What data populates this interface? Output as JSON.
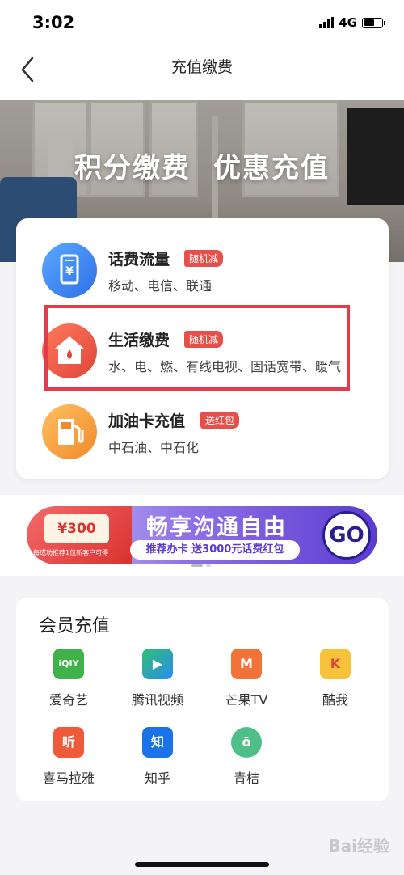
{
  "status_bar": {
    "time": "3:02",
    "network": "4G"
  },
  "nav": {
    "title": "充值缴费"
  },
  "hero": {
    "left_text": "积分缴费",
    "right_text": "优惠充值"
  },
  "services": [
    {
      "name": "话费流量",
      "tag": "随机减",
      "desc": "移动、电信、联通"
    },
    {
      "name": "生活缴费",
      "tag": "随机减",
      "desc": "水、电、燃、有线电视、固话宽带、暖气"
    },
    {
      "name": "加油卡充值",
      "tag": "送红包",
      "desc": "中石油、中石化"
    }
  ],
  "promo": {
    "coupon": "¥300",
    "note": "每成功推荐1位新客户可得",
    "title": "畅享沟通自由",
    "subtitle": "推荐办卡 送3000元话费红包",
    "go": "GO"
  },
  "member": {
    "title": "会员充值",
    "items": [
      {
        "label": "爱奇艺",
        "icon_text": "iQIY"
      },
      {
        "label": "腾讯视频",
        "icon_text": "▶"
      },
      {
        "label": "芒果TV",
        "icon_text": "M"
      },
      {
        "label": "酷我",
        "icon_text": "K"
      },
      {
        "label": "喜马拉雅",
        "icon_text": "听"
      },
      {
        "label": "知乎",
        "icon_text": "知"
      },
      {
        "label": "青桔",
        "icon_text": "ō"
      }
    ]
  },
  "watermark": "Bai经验",
  "colors": {
    "tag_red": "#e6504a",
    "highlight": "#e23c4c",
    "promo_purple": "#5b3bd0"
  }
}
